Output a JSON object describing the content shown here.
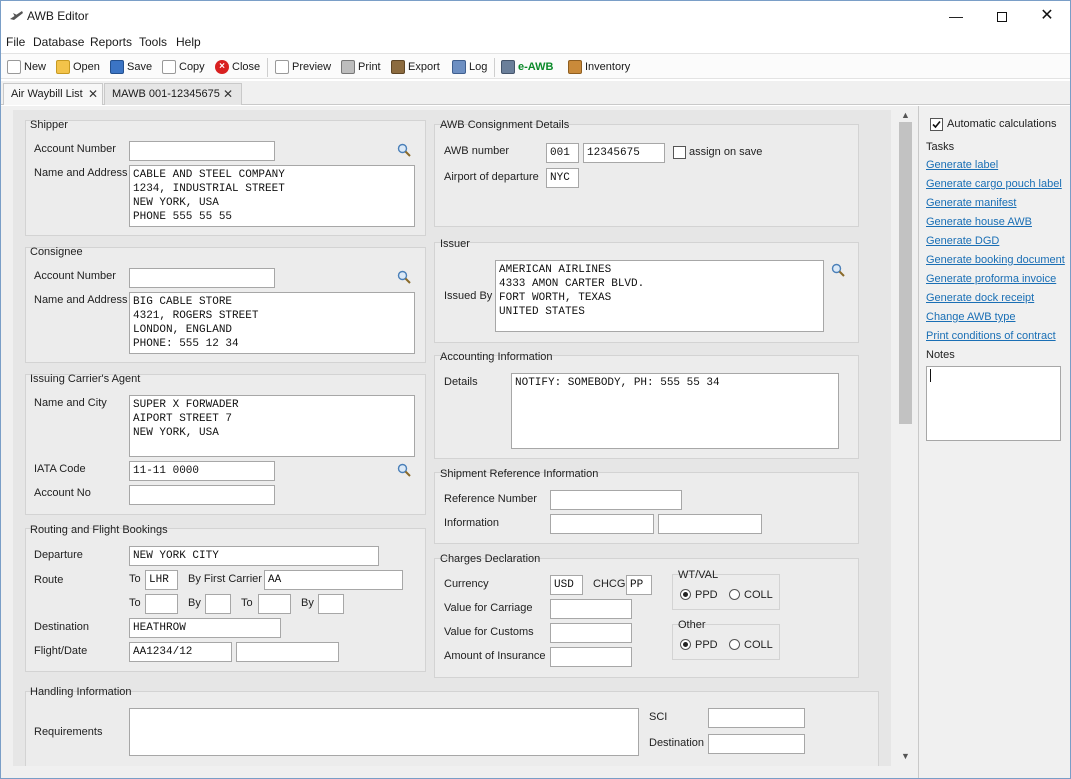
{
  "window": {
    "title": "AWB Editor"
  },
  "menu": [
    "File",
    "Database",
    "Reports",
    "Tools",
    "Help"
  ],
  "toolbar": {
    "new": "New",
    "open": "Open",
    "save": "Save",
    "copy": "Copy",
    "close": "Close",
    "preview": "Preview",
    "print": "Print",
    "export": "Export",
    "log": "Log",
    "eawb": "e-AWB",
    "inventory": "Inventory"
  },
  "tabs": [
    "Air Waybill List",
    "MAWB 001-12345675"
  ],
  "shipper": {
    "title": "Shipper",
    "account_label": "Account Number",
    "account_value": "",
    "name_label": "Name and Address",
    "name_lines": [
      "CABLE AND STEEL COMPANY",
      "1234, INDUSTRIAL STREET",
      "NEW YORK, USA",
      "PHONE 555 55 55"
    ]
  },
  "consignee": {
    "title": "Consignee",
    "account_label": "Account Number",
    "account_value": "",
    "name_label": "Name and Address",
    "name_lines": [
      "BIG CABLE STORE",
      "4321, ROGERS STREET",
      "LONDON, ENGLAND",
      "PHONE: 555 12 34"
    ]
  },
  "agent": {
    "title": "Issuing Carrier's Agent",
    "name_label": "Name and City",
    "name_lines": [
      "SUPER X FORWADER",
      "AIPORT STREET 7",
      "NEW YORK, USA"
    ],
    "iata_label": "IATA Code",
    "iata_value": "11-11 0000",
    "account_label": "Account No",
    "account_value": ""
  },
  "routing": {
    "title": "Routing and Flight Bookings",
    "departure_label": "Departure",
    "departure_value": "NEW YORK CITY",
    "route_label": "Route",
    "to_label": "To",
    "to1": "LHR",
    "by_first_label": "By First Carrier",
    "by_first": "AA",
    "to2": "",
    "by2": "",
    "to3": "",
    "by3": "",
    "by_label": "By",
    "destination_label": "Destination",
    "destination_value": "HEATHROW",
    "flight_label": "Flight/Date",
    "flight_value": "AA1234/12",
    "flight_value2": ""
  },
  "consignment": {
    "title": "AWB Consignment Details",
    "awb_label": "AWB number",
    "awb_prefix": "001",
    "awb_number": "12345675",
    "assign_label": "assign on save",
    "airport_label": "Airport of departure",
    "airport_value": "NYC"
  },
  "issuer": {
    "title": "Issuer",
    "issued_label": "Issued By",
    "lines": [
      "AMERICAN AIRLINES",
      "4333 AMON CARTER BLVD.",
      "FORT WORTH, TEXAS",
      "UNITED STATES"
    ]
  },
  "accounting": {
    "title": "Accounting Information",
    "details_label": "Details",
    "details_value": "NOTIFY: SOMEBODY, PH: 555 55 34"
  },
  "shipment_ref": {
    "title": "Shipment Reference Information",
    "ref_label": "Reference Number",
    "info_label": "Information"
  },
  "charges": {
    "title": "Charges Declaration",
    "currency_label": "Currency",
    "currency_value": "USD",
    "chcg_label": "CHCG",
    "chcg_value": "PP",
    "carriage_label": "Value for Carriage",
    "customs_label": "Value for Customs",
    "insurance_label": "Amount of Insurance",
    "wtval_title": "WT/VAL",
    "other_title": "Other",
    "ppd": "PPD",
    "coll": "COLL"
  },
  "handling": {
    "title": "Handling Information",
    "req_label": "Requirements",
    "sci_label": "SCI",
    "dest_label": "Destination"
  },
  "sidebar": {
    "auto_calc": "Automatic calculations",
    "tasks_title": "Tasks",
    "tasks": [
      "Generate label",
      "Generate cargo pouch label",
      "Generate manifest",
      "Generate house AWB",
      "Generate DGD",
      "Generate booking document",
      "Generate proforma invoice",
      "Generate dock receipt",
      "Change AWB type",
      "Print conditions of contract"
    ],
    "notes_title": "Notes"
  },
  "colors": {
    "link": "#1a6fb5",
    "eawb": "#0b8a2a",
    "close_red": "#d82020"
  }
}
